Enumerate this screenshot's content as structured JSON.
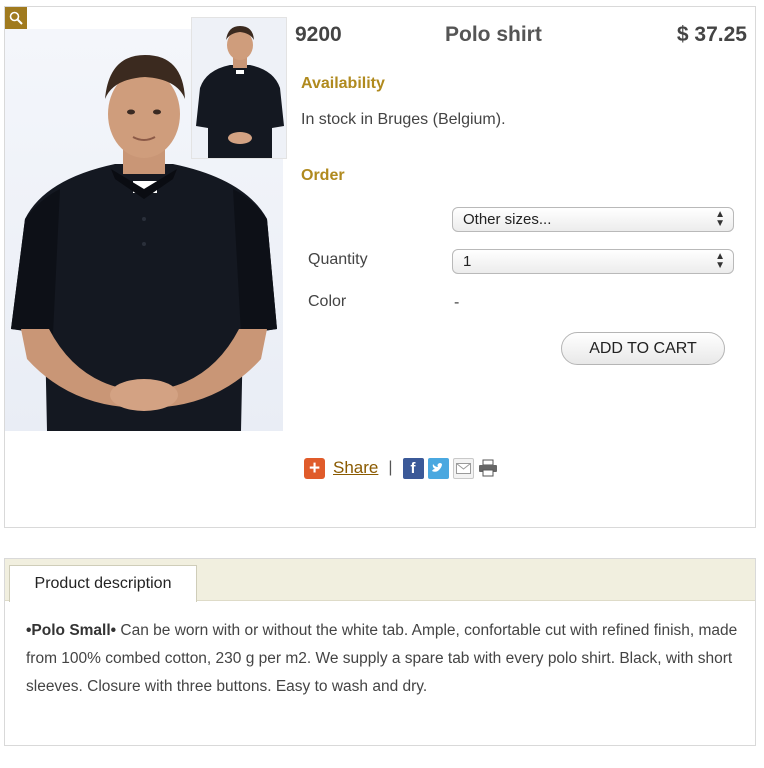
{
  "product": {
    "sku": "9200",
    "name": "Polo shirt",
    "price": "$ 37.25"
  },
  "availability": {
    "heading": "Availability",
    "text": "In stock in Bruges (Belgium)."
  },
  "order": {
    "heading": "Order",
    "size_select": "Other sizes...",
    "quantity_label": "Quantity",
    "quantity_value": "1",
    "color_label": "Color",
    "color_value": "-",
    "add_to_cart": "ADD TO CART"
  },
  "share": {
    "label": "Share",
    "separator": "|",
    "icons": [
      "share-plus-icon",
      "facebook-icon",
      "twitter-icon",
      "email-icon",
      "print-icon"
    ]
  },
  "description": {
    "tab_label": "Product description",
    "lead": "•Polo Small•",
    "body": " Can be worn with or without the white tab. Ample, confortable cut with refined finish, made from 100% combed cotton, 230 g per m2. We supply a spare tab with every polo shirt. Black, with short sleeves. Closure with three buttons. Easy to wash and dry."
  },
  "colors": {
    "accent": "#b08a1e",
    "link": "#8a5a00",
    "share": "#e05b2a",
    "facebook": "#3b5998",
    "twitter": "#4aa8e0",
    "tab_bar": "#f1efdf"
  }
}
